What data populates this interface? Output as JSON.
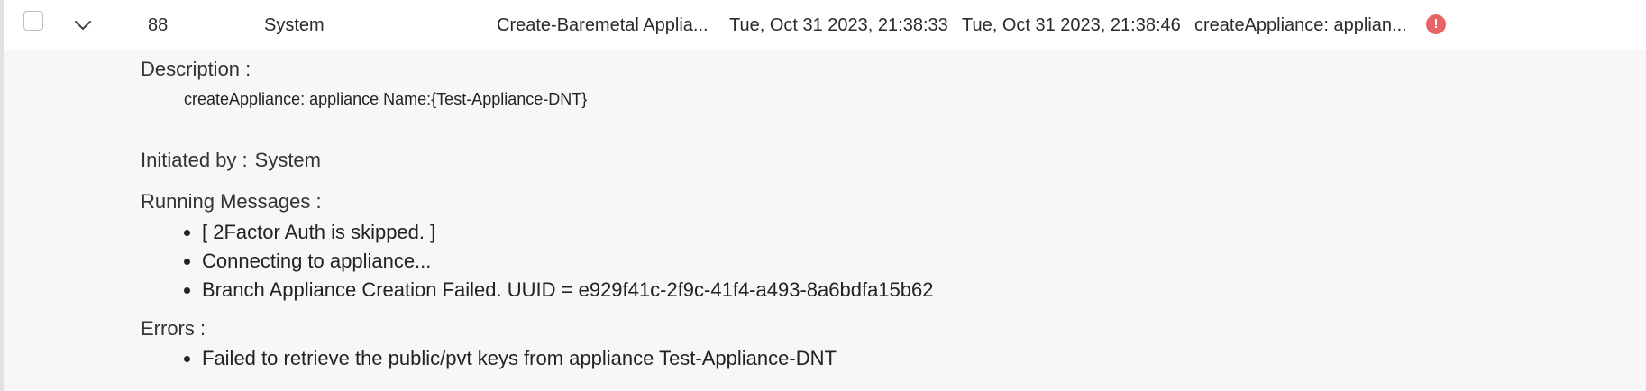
{
  "row": {
    "id": "88",
    "initiated_by": "System",
    "task_name": "Create-Baremetal Applia...",
    "start_time": "Tue, Oct 31 2023, 21:38:33",
    "end_time": "Tue, Oct 31 2023, 21:38:46",
    "description_short": "createAppliance:  applian...",
    "status_icon": "error-icon",
    "status_color": "#e86464"
  },
  "detail": {
    "description_label": "Description :",
    "description_value": "createAppliance: appliance Name:{Test-Appliance-DNT}",
    "initiated_label": "Initiated by :",
    "initiated_value": "System",
    "running_label": "Running Messages :",
    "running_messages": [
      "[ 2Factor Auth is skipped. ]",
      "Connecting to appliance...",
      "Branch Appliance Creation Failed. UUID = e929f41c-2f9c-41f4-a493-8a6bdfa15b62"
    ],
    "errors_label": "Errors :",
    "errors": [
      "Failed to retrieve the public/pvt keys from appliance Test-Appliance-DNT"
    ]
  }
}
